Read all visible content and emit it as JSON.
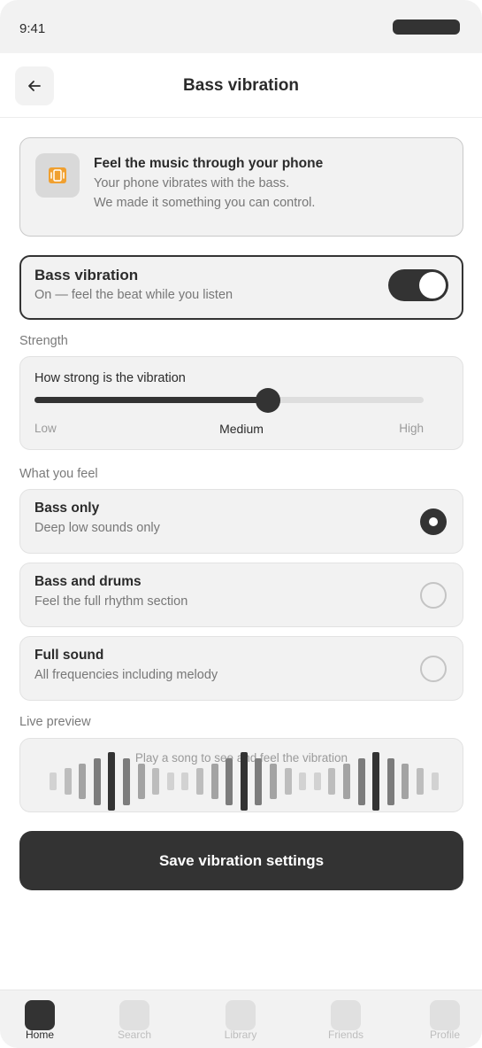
{
  "status_bar": {
    "time": "9:41"
  },
  "header": {
    "title": "Bass vibration",
    "back_icon": "arrow-left-icon"
  },
  "info_card": {
    "icon": "phone-vibrate-icon",
    "title": "Feel the music through your phone",
    "line1": "Your phone vibrates with the bass.",
    "line2": "We made it something you can control."
  },
  "toggle": {
    "title": "Bass vibration",
    "subtitle": "On — feel the beat while you listen",
    "on": true
  },
  "strength": {
    "section_label": "Strength",
    "question": "How strong is the vibration",
    "value_fraction": 0.6,
    "low_label": "Low",
    "current_label": "Medium",
    "high_label": "High"
  },
  "feel": {
    "section_label": "What you feel",
    "options": [
      {
        "title": "Bass only",
        "subtitle": "Deep low sounds only",
        "selected": true
      },
      {
        "title": "Bass and drums",
        "subtitle": "Feel the full rhythm section",
        "selected": false
      },
      {
        "title": "Full sound",
        "subtitle": "All frequencies including melody",
        "selected": false
      }
    ]
  },
  "preview": {
    "section_label": "Live preview",
    "placeholder": "Play a song to see and feel the vibration",
    "bar_levels": [
      0.3,
      0.45,
      0.6,
      0.8,
      1.0,
      0.8,
      0.6,
      0.45,
      0.3,
      0.3,
      0.45,
      0.6,
      0.8,
      1.0,
      0.8,
      0.6,
      0.45,
      0.3,
      0.3,
      0.45,
      0.6,
      0.8,
      1.0,
      0.8,
      0.6,
      0.45,
      0.3
    ]
  },
  "save_button": {
    "label": "Save vibration settings"
  },
  "tab_bar": {
    "tabs": [
      {
        "label": "Home",
        "active": true
      },
      {
        "label": "Search",
        "active": false
      },
      {
        "label": "Library",
        "active": false
      },
      {
        "label": "Friends",
        "active": false
      },
      {
        "label": "Profile",
        "active": false
      }
    ]
  },
  "colors": {
    "dark": "#333333",
    "card": "#f2f2f2",
    "accent_orange": "#f0a030"
  }
}
